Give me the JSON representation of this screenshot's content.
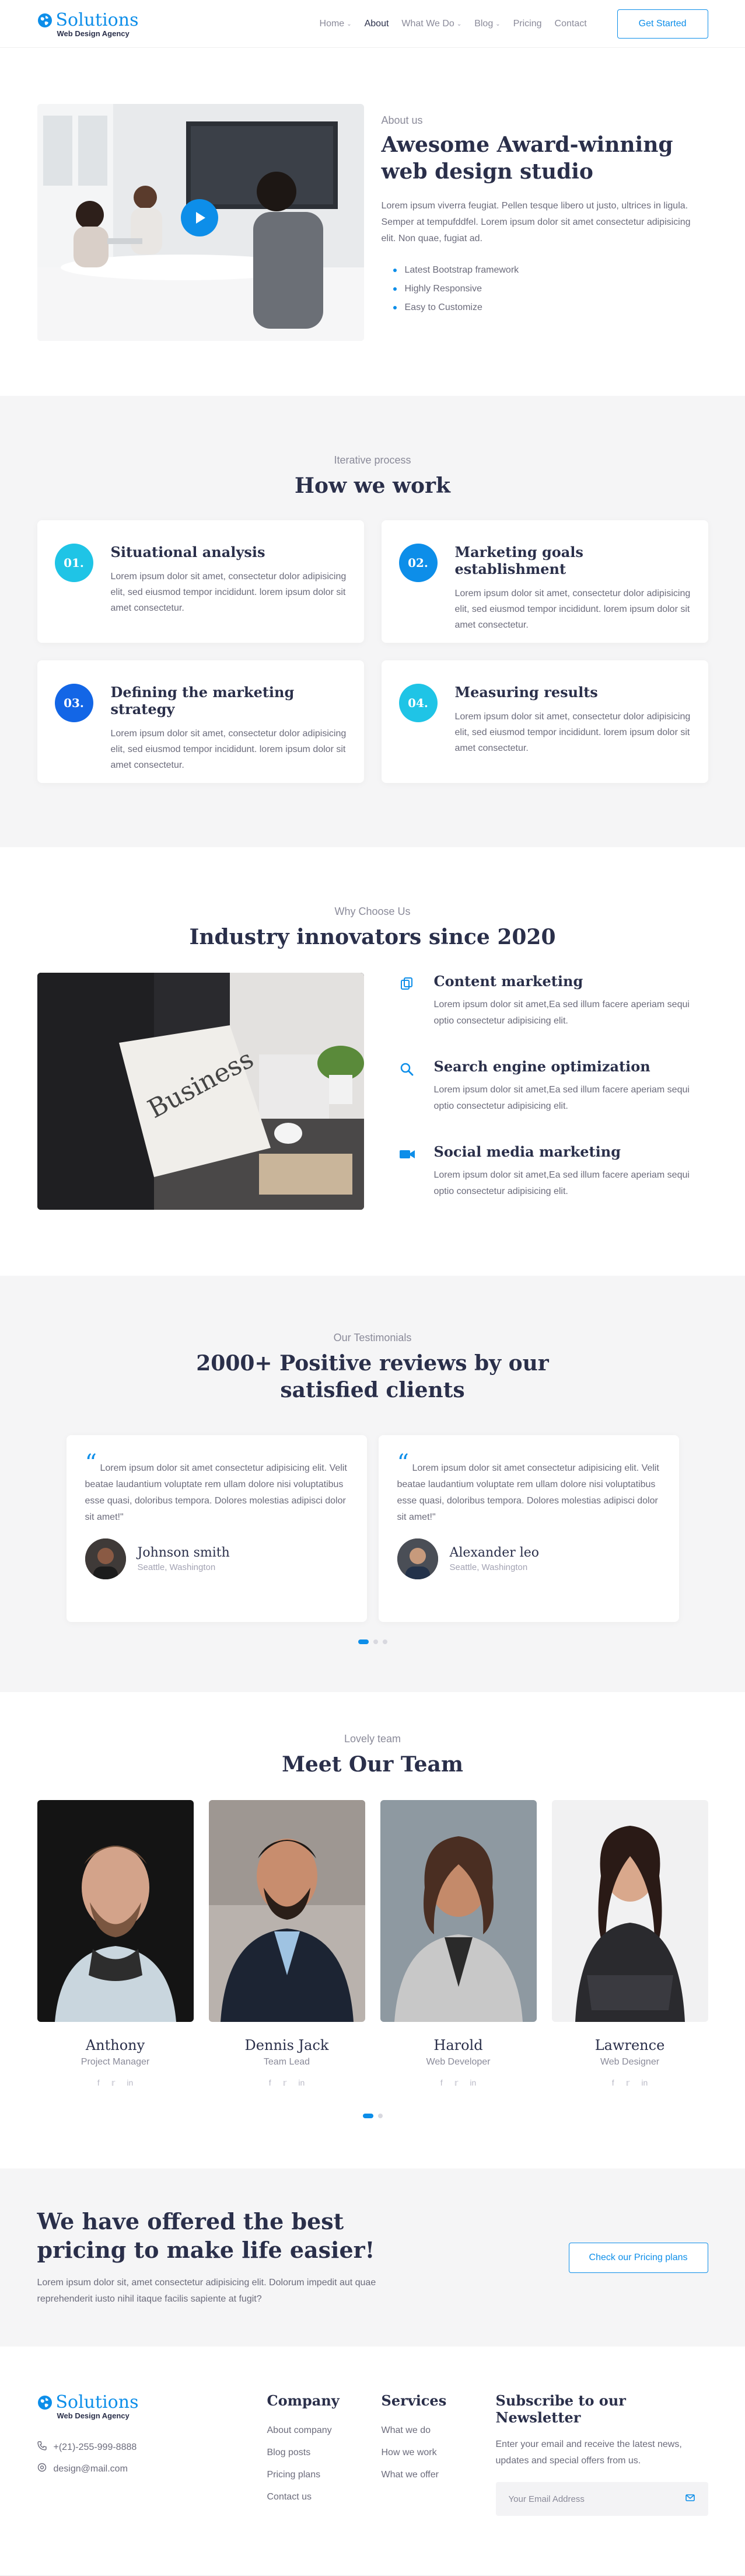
{
  "header": {
    "logo_name": "Solutions",
    "logo_sub": "Web Design Agency",
    "nav": [
      {
        "label": "Home",
        "dropdown": true,
        "active": false
      },
      {
        "label": "About",
        "dropdown": false,
        "active": true
      },
      {
        "label": "What We Do",
        "dropdown": true,
        "active": false
      },
      {
        "label": "Blog",
        "dropdown": true,
        "active": false
      },
      {
        "label": "Pricing",
        "dropdown": false,
        "active": false
      },
      {
        "label": "Contact",
        "dropdown": false,
        "active": false
      }
    ],
    "cta_label": "Get Started"
  },
  "about": {
    "eyebrow": "About us",
    "title": "Awesome Award-winning web design studio",
    "desc": "Lorem ipsum viverra feugiat. Pellen tesque libero ut justo, ultrices in ligula. Semper at tempufddfel. Lorem ipsum dolor sit amet consectetur adipisicing elit. Non quae, fugiat ad.",
    "list": [
      "Latest Bootstrap framework",
      "Highly Responsive",
      "Easy to Customize"
    ]
  },
  "process": {
    "eyebrow": "Iterative process",
    "title": "How we work",
    "cards": [
      {
        "num": "01.",
        "title": "Situational analysis",
        "text": "Lorem ipsum dolor sit amet, consectetur dolor adipisicing elit, sed eiusmod tempor incididunt. lorem ipsum dolor sit amet consectetur."
      },
      {
        "num": "02.",
        "title": "Marketing goals establishment",
        "text": "Lorem ipsum dolor sit amet, consectetur dolor adipisicing elit, sed eiusmod tempor incididunt. lorem ipsum dolor sit amet consectetur."
      },
      {
        "num": "03.",
        "title": "Defining the marketing strategy",
        "text": "Lorem ipsum dolor sit amet, consectetur dolor adipisicing elit, sed eiusmod tempor incididunt. lorem ipsum dolor sit amet consectetur."
      },
      {
        "num": "04.",
        "title": "Measuring results",
        "text": "Lorem ipsum dolor sit amet, consectetur dolor adipisicing elit, sed eiusmod tempor incididunt. lorem ipsum dolor sit amet consectetur."
      }
    ]
  },
  "why": {
    "eyebrow": "Why Choose Us",
    "title": "Industry innovators since 2020",
    "features": [
      {
        "icon": "copy-icon",
        "title": "Content marketing",
        "text": "Lorem ipsum dolor sit amet,Ea sed illum facere aperiam sequi optio consectetur adipisicing elit."
      },
      {
        "icon": "search-icon",
        "title": "Search engine optimization",
        "text": "Lorem ipsum dolor sit amet,Ea sed illum facere aperiam sequi optio consectetur adipisicing elit."
      },
      {
        "icon": "video-camera-icon",
        "title": "Social media marketing",
        "text": "Lorem ipsum dolor sit amet,Ea sed illum facere aperiam sequi optio consectetur adipisicing elit."
      }
    ]
  },
  "testimonials": {
    "eyebrow": "Our Testimonials",
    "title": "2000+ Positive reviews by our satisfied clients",
    "items": [
      {
        "text": "Lorem ipsum dolor sit amet consectetur adipisicing elit. Velit beatae laudantium voluptate rem ullam dolore nisi voluptatibus esse quasi, doloribus tempora. Dolores molestias adipisci dolor sit amet!\"",
        "name": "Johnson smith",
        "location": "Seattle, Washington"
      },
      {
        "text": "Lorem ipsum dolor sit amet consectetur adipisicing elit. Velit beatae laudantium voluptate rem ullam dolore nisi voluptatibus esse quasi, doloribus tempora. Dolores molestias adipisci dolor sit amet!\"",
        "name": "Alexander leo",
        "location": "Seattle, Washington"
      }
    ],
    "active_dot": 0,
    "dot_count": 3
  },
  "team": {
    "eyebrow": "Lovely team",
    "title": "Meet Our Team",
    "members": [
      {
        "name": "Anthony",
        "role": "Project Manager"
      },
      {
        "name": "Dennis Jack",
        "role": "Team Lead"
      },
      {
        "name": "Harold",
        "role": "Web Developer"
      },
      {
        "name": "Lawrence",
        "role": "Web Designer"
      }
    ],
    "active_dot": 0,
    "dot_count": 2
  },
  "cta": {
    "title": "We have offered the best pricing to make life easier!",
    "text": "Lorem ipsum dolor sit, amet consectetur adipisicing elit. Dolorum impedit aut quae reprehenderit iusto nihil itaque facilis sapiente at fugit?",
    "button_label": "Check our Pricing plans"
  },
  "footer": {
    "logo_name": "Solutions",
    "logo_sub": "Web Design Agency",
    "phone": "+(21)-255-999-8888",
    "email": "design@mail.com",
    "company_title": "Company",
    "company_links": [
      "About company",
      "Blog posts",
      "Pricing plans",
      "Contact us"
    ],
    "services_title": "Services",
    "services_links": [
      "What we do",
      "How we work",
      "What we offer"
    ],
    "newsletter_title": "Subscribe to our Newsletter",
    "newsletter_text": "Enter your email and receive the latest news, updates and special offers from us.",
    "email_placeholder": "Your Email Address"
  },
  "colors": {
    "brand": "#0d8ee9",
    "heading": "#2a2f4a",
    "section_bg": "#f5f5f6"
  }
}
